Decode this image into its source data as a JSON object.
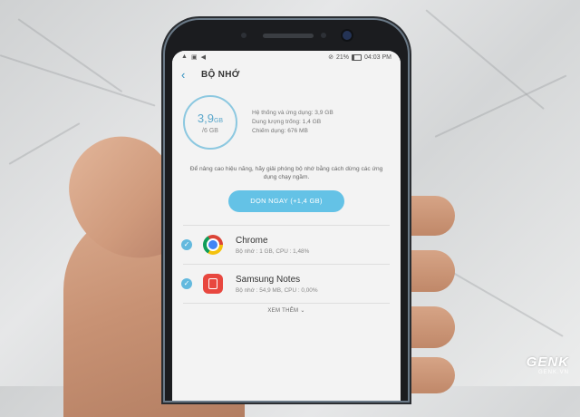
{
  "status_bar": {
    "left_icons": [
      "notification-icon",
      "media-icon",
      "volume-icon"
    ],
    "battery": "21%",
    "time": "04:03 PM"
  },
  "app_bar": {
    "back_icon": "back-arrow-icon",
    "title": "BỘ NHỚ"
  },
  "memory": {
    "used_value": "3,9",
    "used_unit": "GB",
    "total": "/6 GB",
    "used_fraction": 0.65,
    "stats": [
      "Hệ thống và ứng dụng: 3,9 GB",
      "Dung lượng trống: 1,4 GB",
      "Chiếm dụng: 676 MB"
    ]
  },
  "hint_text": "Để nâng cao hiệu năng, hãy giải phóng bộ nhớ bằng cách dừng các ứng dụng chạy ngầm.",
  "clean_button_label": "DỌN NGAY (+1,4 GB)",
  "apps": [
    {
      "name": "Chrome",
      "info": "Bộ nhớ : 1 GB, CPU : 1,48%",
      "checked": true,
      "icon": "chrome-icon"
    },
    {
      "name": "Samsung Notes",
      "info": "Bộ nhớ : 54,9 MB, CPU : 0,00%",
      "checked": true,
      "icon": "samsung-notes-icon"
    }
  ],
  "more_label": "XEM THÊM",
  "watermark": {
    "main": "GENK",
    "sub": "GENK.VN"
  },
  "colors": {
    "accent": "#64c2e6",
    "ring": "#8cc8e0",
    "check": "#63b9de"
  }
}
